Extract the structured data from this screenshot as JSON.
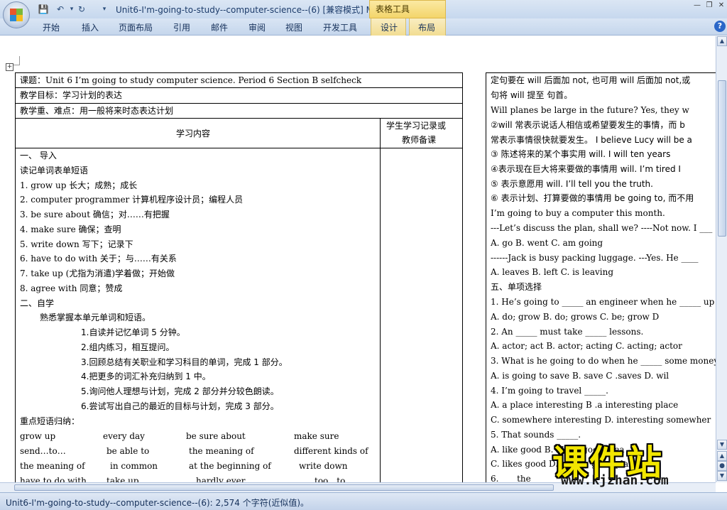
{
  "window": {
    "title": "Unit6-I'm-going-to-study--computer-science--(6) [兼容模式] M",
    "context_tab_group": "表格工具"
  },
  "ribbon": {
    "tabs": [
      "开始",
      "插入",
      "页面布局",
      "引用",
      "邮件",
      "审阅",
      "视图",
      "开发工具",
      "设计",
      "布局"
    ],
    "help_label": "?"
  },
  "left_page": {
    "header_rows": [
      "课题：Unit 6 I’m going to study computer science.     Period 6     Section B selfcheck",
      "教学目标：学习计划的表达",
      "教学重、难点：用一般将来时态表达计划"
    ],
    "col_content_header": "学习内容",
    "col_notes_header_1": "学生学习记录或",
    "col_notes_header_2": "教师备课",
    "body_lines": [
      "一、 导入",
      "读记单词表单短语",
      "1. grow up  长大；成熟；成长",
      "2. computer programmer   计算机程序设计员；编程人员",
      "3. be sure about  确信；对……有把握",
      "4. make sure  确保；查明",
      "5. write down  写下；记录下",
      "6. have to do with  关于；与……有关系",
      "7. take up (尤指为消遣)学着做；开始做",
      "8. agree with  同意；赞成",
      "二、自学",
      "熟悉掌握本单元单词和短语。",
      "1.自读并记忆单词 5 分钟。",
      "2.组内练习，相互提问。",
      "3.回顾总结有关职业和学习科目的单词，完成 1 部分。",
      "4.把更多的词汇补充归纳到 1 中。",
      "5.询问他人理想与计划，完成 2 部分并分较色朗读。",
      "6.尝试写出自己的最近的目标与计划，完成 3 部分。",
      "重点短语归纳："
    ],
    "phrase_rows": [
      [
        "grow up",
        "every day",
        "be sure about",
        "make sure"
      ],
      [
        "send…to…",
        "be able to",
        "the meaning of",
        "different kinds of"
      ],
      [
        "the meaning of",
        "in common",
        "at the beginning of",
        "write down"
      ],
      [
        "have to do with",
        "take up",
        "hardly ever",
        "too…to…"
      ]
    ]
  },
  "right_page": {
    "lines": [
      "定句要在 will 后面加 not, 也可用 will  后面加  not,或",
      "句将 will 提至  句首。",
      "Will planes be large in the future?              Yes, they w",
      "②will 常表示说话人相信或希望要发生的事情，而 b",
      "常表示事情很快就要发生。     I believe Lucy will be a",
      "③ 陈述将来的某个事实用 will.          I will ten years",
      "④表示现在巨大将来要做的事情用 will.     I’m tired I",
      "⑤ 表示意愿用 will.       I’ll tell you the truth.",
      "⑥ 表示计划、打算要做的事情用  be going to,  而不用",
      "I’m going to buy a computer this month.",
      "---Let’s discuss the plan, shall we?        ----Not now. I ___",
      "A. go                    B. went                    C. am going",
      "------Jack is busy packing luggage.          ---Yes. He ____",
      "A. leaves                    B. left                C. is leaving",
      "五、单项选择",
      "1.    He’s going to _____ an engineer when he _____ up",
      "     A. do;   grow     B.    do; grows    C. be; grow    D",
      "2.    An _____ must take _____ lessons.",
      "     A. actor; act      B. actor; acting      C. acting; actor",
      "3.    What is he going to do when he _____ some money",
      "     A. is going to save      B. save      C .saves      D. wil",
      "4.    I’m going to travel _____.",
      "     A. a place interesting              B .a interesting place",
      "     C. somewhere interesting      D. interesting somewher",
      "5.    That sounds _____.",
      "        A. like good           B. like a good idea",
      "     C. likes good         D. likes a good plan",
      "6.    ___   the ___"
    ]
  },
  "status": {
    "text": "Unit6-I'm-going-to-study--computer-science--(6): 2,574 个字符(近似值)。"
  },
  "watermark": {
    "main": "课件站",
    "url": "www.kjzhan.com"
  },
  "colors": {
    "ribbon_bg": "#c5d6ec",
    "context_tab": "#f3d56b",
    "watermark_fill": "#f2e600"
  }
}
